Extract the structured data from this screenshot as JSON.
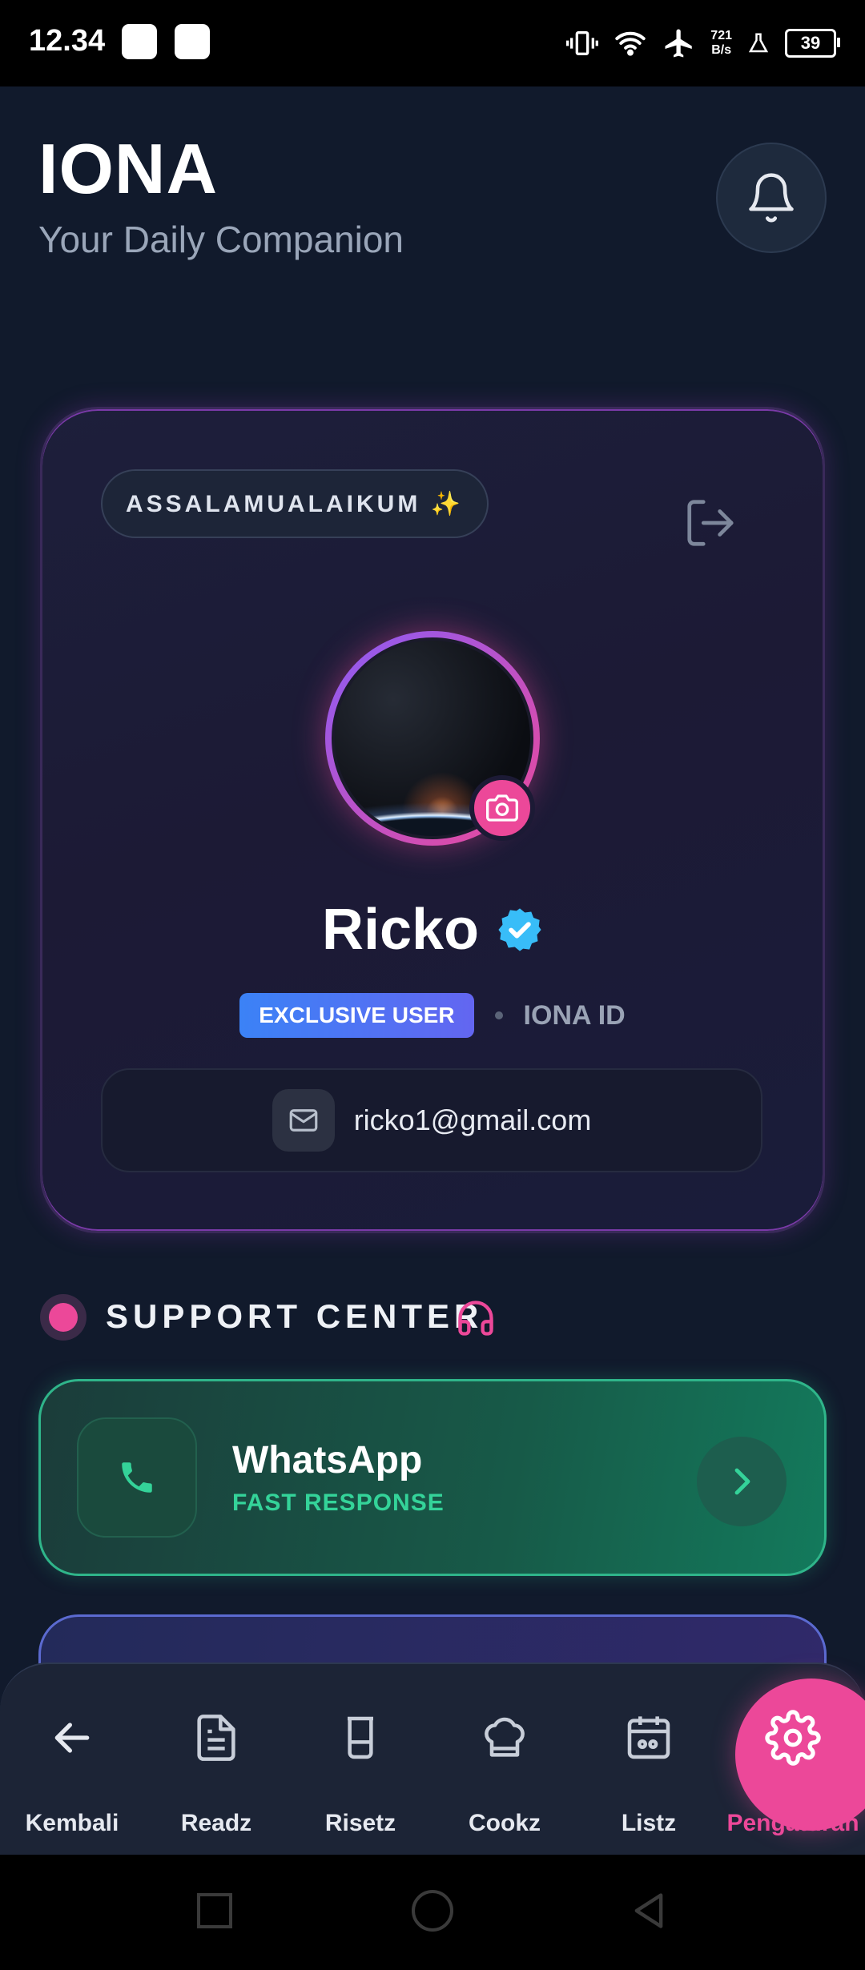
{
  "status_bar": {
    "time": "12.34",
    "speed_value": "721",
    "speed_unit": "B/s",
    "battery": "39"
  },
  "header": {
    "title": "IONA",
    "subtitle": "Your Daily Companion"
  },
  "profile": {
    "greeting": "ASSALAMUALAIKUM ✨",
    "name": "Ricko",
    "badge": "EXCLUSIVE USER",
    "id_label": "IONA ID",
    "email": "ricko1@gmail.com"
  },
  "support": {
    "title": "SUPPORT CENTER",
    "whatsapp": {
      "title": "WhatsApp",
      "subtitle": "FAST RESPONSE"
    }
  },
  "nav": {
    "items": [
      {
        "label": "Kembali",
        "icon": "arrow-left-icon"
      },
      {
        "label": "Readz",
        "icon": "document-icon"
      },
      {
        "label": "Risetz",
        "icon": "beaker-icon"
      },
      {
        "label": "Cookz",
        "icon": "chef-hat-icon"
      },
      {
        "label": "Listz",
        "icon": "list-icon"
      },
      {
        "label": "Pengaturan",
        "icon": "settings-icon"
      }
    ],
    "active": "Pengaturan"
  },
  "colors": {
    "accent": "#ec4899",
    "background": "#111a2c",
    "whatsapp": "#34d399",
    "badge": "#4f7cf6"
  }
}
